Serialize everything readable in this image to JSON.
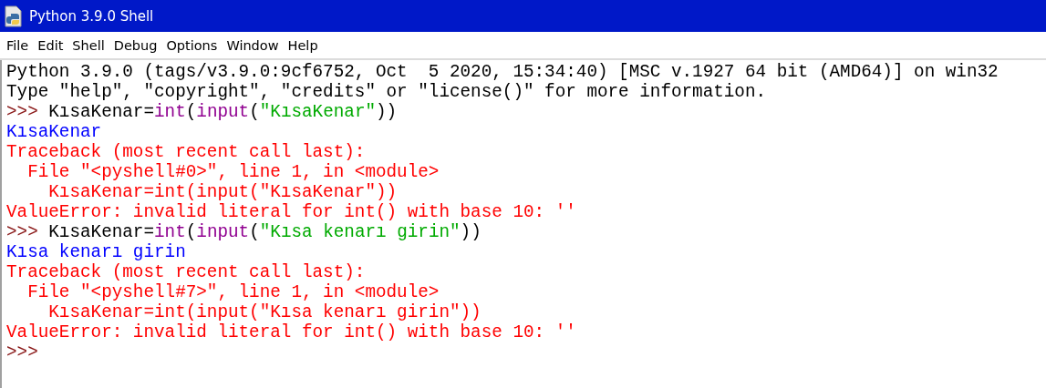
{
  "window": {
    "title": "Python 3.9.0 Shell"
  },
  "menu": [
    "File",
    "Edit",
    "Shell",
    "Debug",
    "Options",
    "Window",
    "Help"
  ],
  "lines": [
    [
      {
        "kind": "normal",
        "text": "Python 3.9.0 (tags/v3.9.0:9cf6752, Oct  5 2020, 15:34:40) [MSC v.1927 64 bit (AMD64)] on win32"
      }
    ],
    [
      {
        "kind": "normal",
        "text": "Type \"help\", \"copyright\", \"credits\" or \"license()\" for more information."
      }
    ],
    [
      {
        "kind": "prompt",
        "text": ">>> "
      },
      {
        "kind": "normal",
        "text": "KısaKenar="
      },
      {
        "kind": "builtin",
        "text": "int"
      },
      {
        "kind": "normal",
        "text": "("
      },
      {
        "kind": "builtin",
        "text": "input"
      },
      {
        "kind": "normal",
        "text": "("
      },
      {
        "kind": "string",
        "text": "\"KısaKenar\""
      },
      {
        "kind": "normal",
        "text": "))"
      }
    ],
    [
      {
        "kind": "stdout",
        "text": "KısaKenar"
      }
    ],
    [
      {
        "kind": "error",
        "text": "Traceback (most recent call last):"
      }
    ],
    [
      {
        "kind": "error",
        "text": "  File \"<pyshell#0>\", line 1, in <module>"
      }
    ],
    [
      {
        "kind": "error",
        "text": "    KısaKenar=int(input(\"KısaKenar\"))"
      }
    ],
    [
      {
        "kind": "error",
        "text": "ValueError: invalid literal for int() with base 10: ''"
      }
    ],
    [
      {
        "kind": "prompt",
        "text": ">>> "
      },
      {
        "kind": "normal",
        "text": "KısaKenar="
      },
      {
        "kind": "builtin",
        "text": "int"
      },
      {
        "kind": "normal",
        "text": "("
      },
      {
        "kind": "builtin",
        "text": "input"
      },
      {
        "kind": "normal",
        "text": "("
      },
      {
        "kind": "string",
        "text": "\"Kısa kenarı girin\""
      },
      {
        "kind": "normal",
        "text": "))"
      }
    ],
    [
      {
        "kind": "stdout",
        "text": "Kısa kenarı girin"
      }
    ],
    [
      {
        "kind": "error",
        "text": "Traceback (most recent call last):"
      }
    ],
    [
      {
        "kind": "error",
        "text": "  File \"<pyshell#7>\", line 1, in <module>"
      }
    ],
    [
      {
        "kind": "error",
        "text": "    KısaKenar=int(input(\"Kısa kenarı girin\"))"
      }
    ],
    [
      {
        "kind": "error",
        "text": "ValueError: invalid literal for int() with base 10: ''"
      }
    ],
    [
      {
        "kind": "prompt",
        "text": ">>>"
      }
    ]
  ]
}
